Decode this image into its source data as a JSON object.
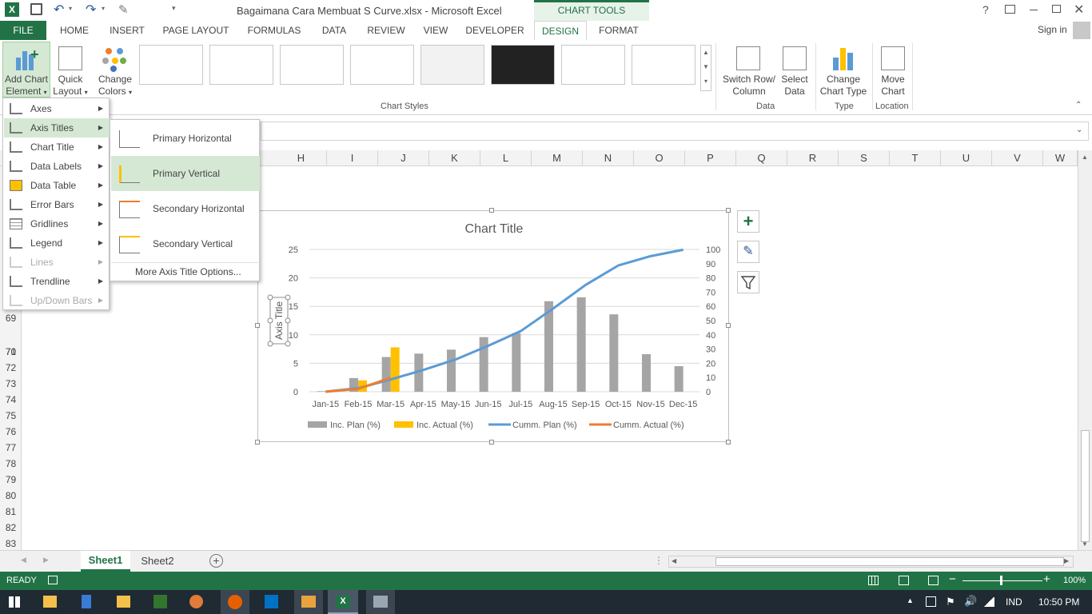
{
  "title_bar": {
    "doc_title": "Bagaimana Cara Membuat S Curve.xlsx - Microsoft Excel",
    "chart_tools": "CHART TOOLS"
  },
  "ribbon_tabs": [
    "FILE",
    "HOME",
    "INSERT",
    "PAGE LAYOUT",
    "FORMULAS",
    "DATA",
    "REVIEW",
    "VIEW",
    "DEVELOPER",
    "DESIGN",
    "FORMAT"
  ],
  "sign_in": "Sign in",
  "ribbon": {
    "add_chart_element": [
      "Add Chart",
      "Element"
    ],
    "quick_layout": [
      "Quick",
      "Layout"
    ],
    "change_colors": [
      "Change",
      "Colors"
    ],
    "chart_styles_label": "Chart Styles",
    "switch_row_col": [
      "Switch Row/",
      "Column"
    ],
    "select_data": [
      "Select",
      "Data"
    ],
    "data_group": "Data",
    "change_chart_type": [
      "Change",
      "Chart Type"
    ],
    "type_group": "Type",
    "move_chart": [
      "Move",
      "Chart"
    ],
    "location_group": "Location"
  },
  "columns": [
    "H",
    "I",
    "J",
    "K",
    "L",
    "M",
    "N",
    "O",
    "P",
    "Q",
    "R",
    "S",
    "T",
    "U",
    "V",
    "W"
  ],
  "rows": [
    "69",
    "70",
    "71",
    "72",
    "73",
    "74",
    "75",
    "76",
    "77",
    "78",
    "79",
    "80",
    "81",
    "82",
    "83"
  ],
  "menu": {
    "items": [
      {
        "label": "Axes",
        "enabled": true
      },
      {
        "label": "Axis Titles",
        "enabled": true
      },
      {
        "label": "Chart Title",
        "enabled": true
      },
      {
        "label": "Data Labels",
        "enabled": true
      },
      {
        "label": "Data Table",
        "enabled": true
      },
      {
        "label": "Error Bars",
        "enabled": true
      },
      {
        "label": "Gridlines",
        "enabled": true
      },
      {
        "label": "Legend",
        "enabled": true
      },
      {
        "label": "Lines",
        "enabled": false
      },
      {
        "label": "Trendline",
        "enabled": true
      },
      {
        "label": "Up/Down Bars",
        "enabled": false
      }
    ],
    "highlighted": "Axis Titles"
  },
  "submenu": {
    "items": [
      "Primary Horizontal",
      "Primary Vertical",
      "Secondary Horizontal",
      "Secondary Vertical"
    ],
    "more": "More Axis Title Options...",
    "highlighted": "Primary Vertical"
  },
  "sheets": [
    "Sheet1",
    "Sheet2"
  ],
  "status": {
    "ready": "READY",
    "zoom": "100%"
  },
  "taskbar": {
    "lang": "IND",
    "time": "10:50 PM"
  },
  "chart_data": {
    "type": "bar",
    "title": "Chart Title",
    "ylabel": "Axis Title",
    "categories": [
      "Jan-15",
      "Feb-15",
      "Mar-15",
      "Apr-15",
      "May-15",
      "Jun-15",
      "Jul-15",
      "Aug-15",
      "Sep-15",
      "Oct-15",
      "Nov-15",
      "Dec-15"
    ],
    "ylim": [
      0,
      25
    ],
    "y2lim": [
      0,
      100
    ],
    "yticks": [
      0,
      5,
      10,
      15,
      20,
      25
    ],
    "y2ticks": [
      0,
      10,
      20,
      30,
      40,
      50,
      60,
      70,
      80,
      90,
      100
    ],
    "series": [
      {
        "name": "Inc. Plan (%)",
        "type": "bar",
        "axis": "primary",
        "color": "#a5a5a5",
        "values": [
          0.1,
          2.4,
          6.1,
          6.7,
          7.4,
          9.6,
          10.3,
          15.9,
          16.6,
          13.6,
          6.6,
          4.5
        ]
      },
      {
        "name": "Inc. Actual (%)",
        "type": "bar",
        "axis": "primary",
        "color": "#ffc000",
        "values": [
          0,
          2.0,
          7.8,
          null,
          null,
          null,
          null,
          null,
          null,
          null,
          null,
          null
        ]
      },
      {
        "name": "Cumm. Plan (%)",
        "type": "line",
        "axis": "secondary",
        "color": "#5b9bd5",
        "values": [
          0.1,
          2.5,
          8.6,
          15.3,
          22.7,
          32.3,
          42.6,
          58.5,
          75.1,
          88.7,
          95.3,
          99.8
        ]
      },
      {
        "name": "Cumm. Actual (%)",
        "type": "line",
        "axis": "secondary",
        "color": "#ed7d31",
        "values": [
          0,
          2.0,
          9.8,
          null,
          null,
          null,
          null,
          null,
          null,
          null,
          null,
          null
        ]
      }
    ],
    "legend": "bottom",
    "grid": true
  }
}
